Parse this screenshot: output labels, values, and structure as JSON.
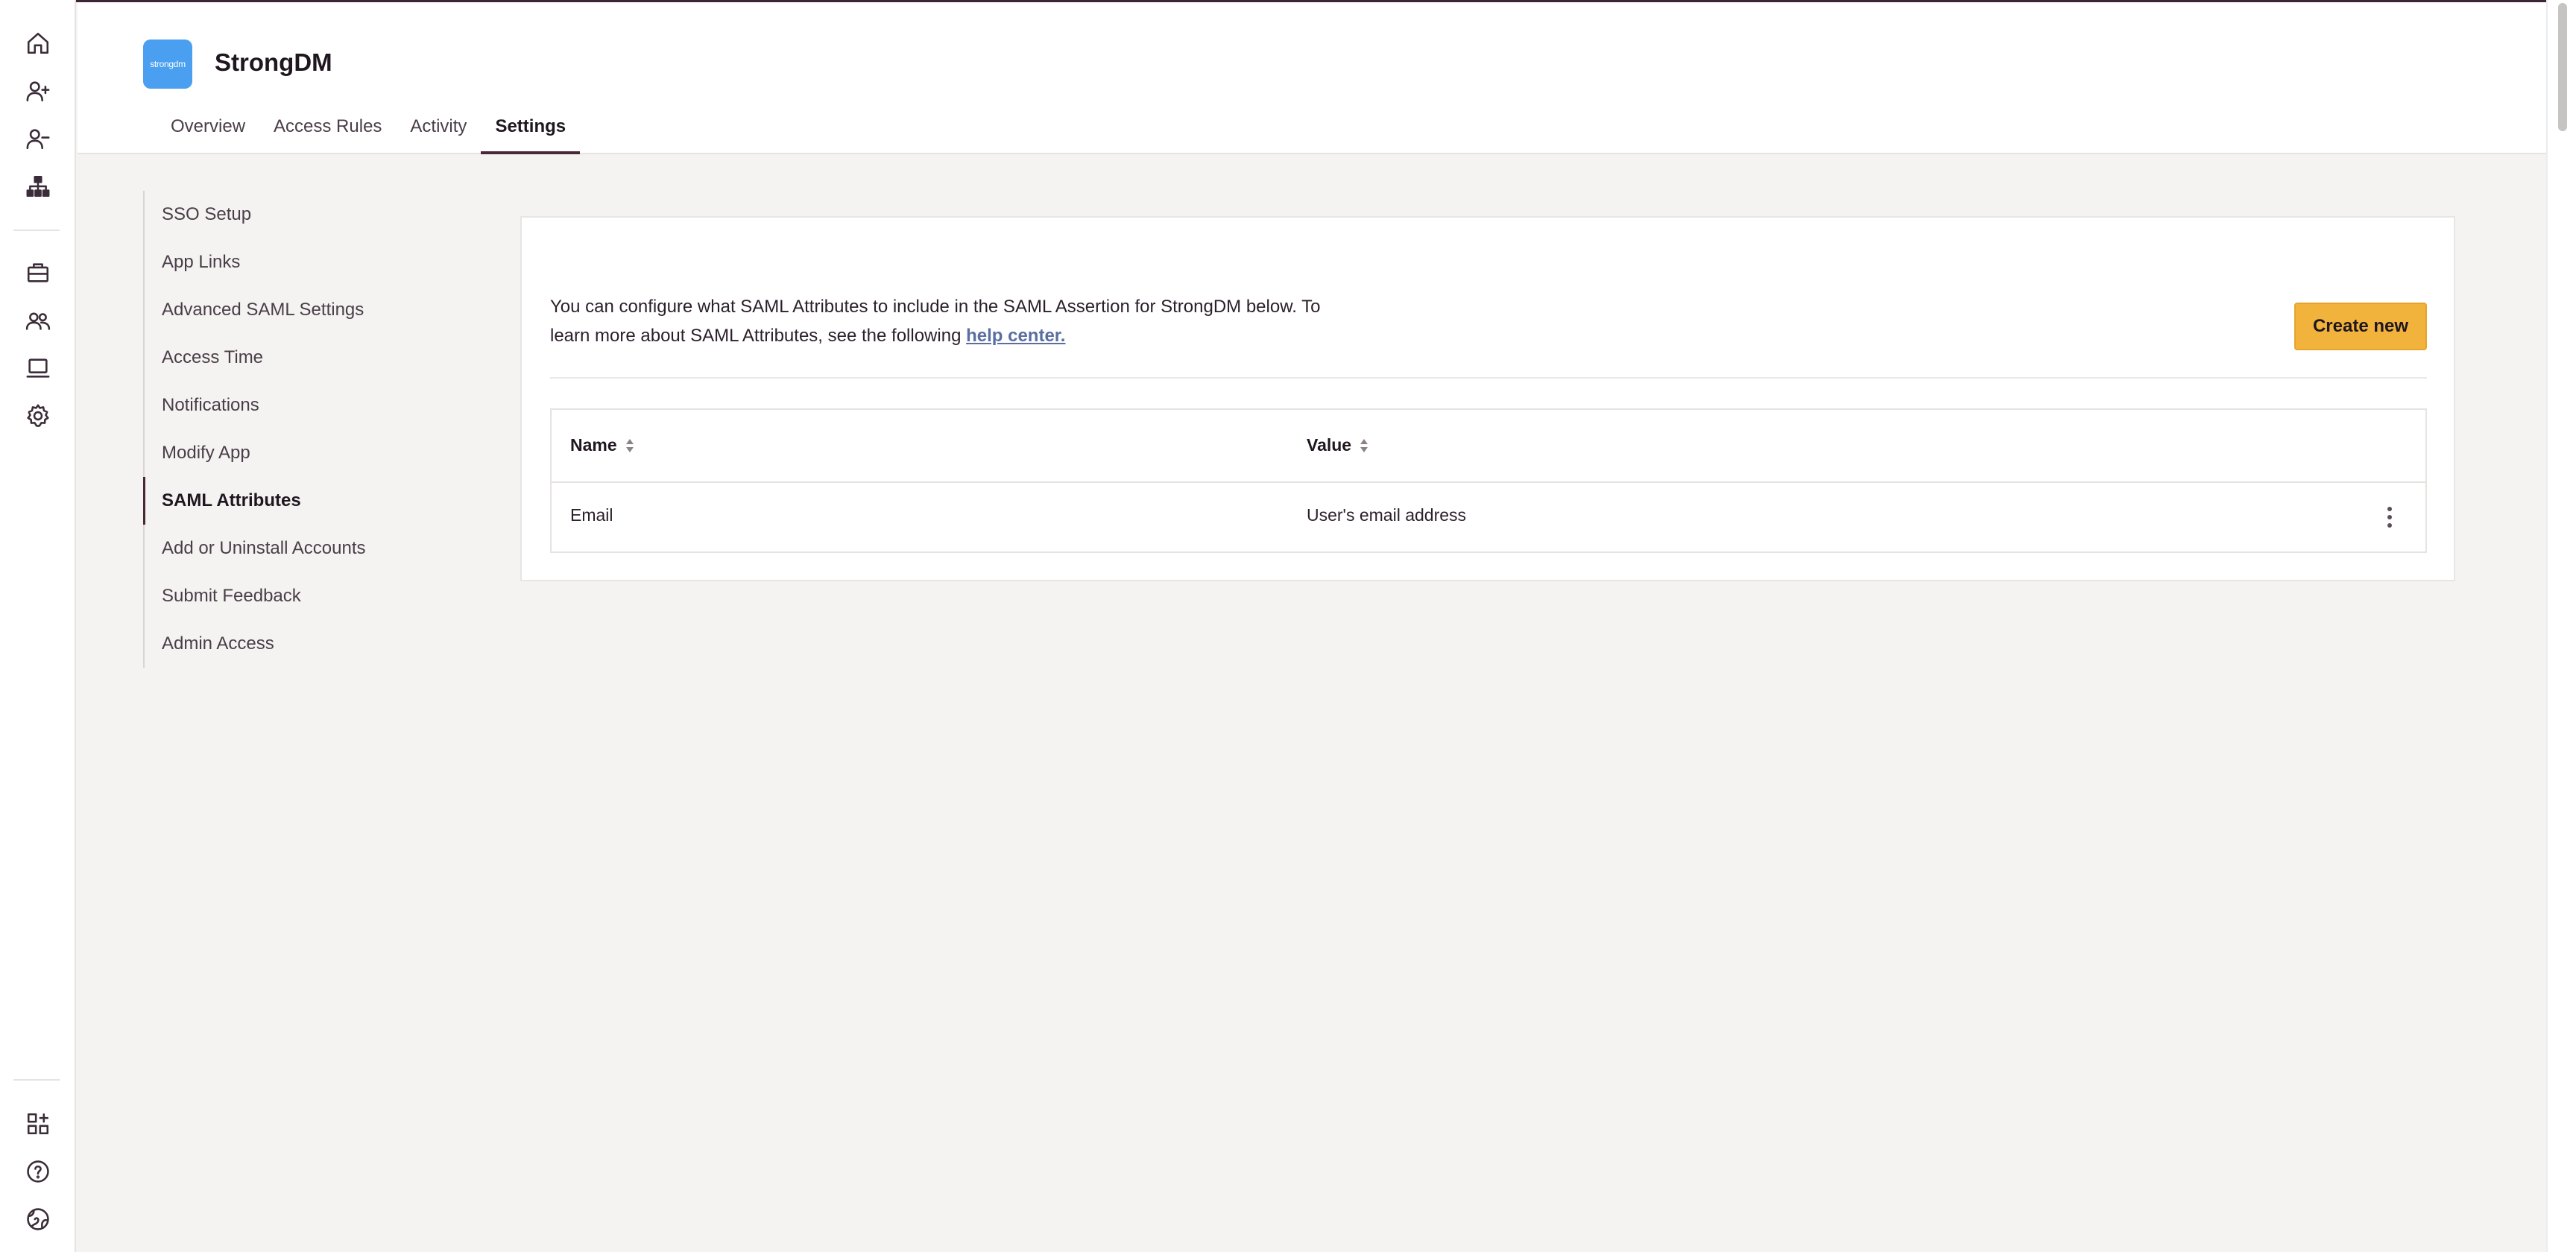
{
  "app": {
    "name": "StrongDM",
    "logo_text": "strongdm",
    "logo_color": "#4b9ff0"
  },
  "rail": {
    "icons": [
      "home-icon",
      "user-plus-icon",
      "user-minus-icon",
      "hierarchy-icon",
      "briefcase-icon",
      "users-icon",
      "laptop-icon",
      "gear-icon",
      "apps-add-icon",
      "help-icon",
      "globe-icon"
    ]
  },
  "tabs": [
    {
      "label": "Overview"
    },
    {
      "label": "Access Rules"
    },
    {
      "label": "Activity"
    },
    {
      "label": "Settings",
      "active": true
    }
  ],
  "sidenav": {
    "items": [
      {
        "label": "SSO Setup"
      },
      {
        "label": "App Links"
      },
      {
        "label": "Advanced SAML Settings"
      },
      {
        "label": "Access Time"
      },
      {
        "label": "Notifications"
      },
      {
        "label": "Modify App"
      },
      {
        "label": "SAML Attributes",
        "active": true
      },
      {
        "label": "Add or Uninstall Accounts"
      },
      {
        "label": "Submit Feedback"
      },
      {
        "label": "Admin Access"
      }
    ]
  },
  "main": {
    "intro_text": "You can configure what SAML Attributes to include in the SAML Assertion for StrongDM below. To learn more about SAML Attributes, see the following",
    "help_link": "help center.",
    "create_button": "Create new",
    "accent_color": "#f2b33d",
    "table": {
      "columns": [
        "Name",
        "Value"
      ],
      "rows": [
        {
          "name": "Email",
          "value": "User's email address"
        }
      ]
    }
  }
}
